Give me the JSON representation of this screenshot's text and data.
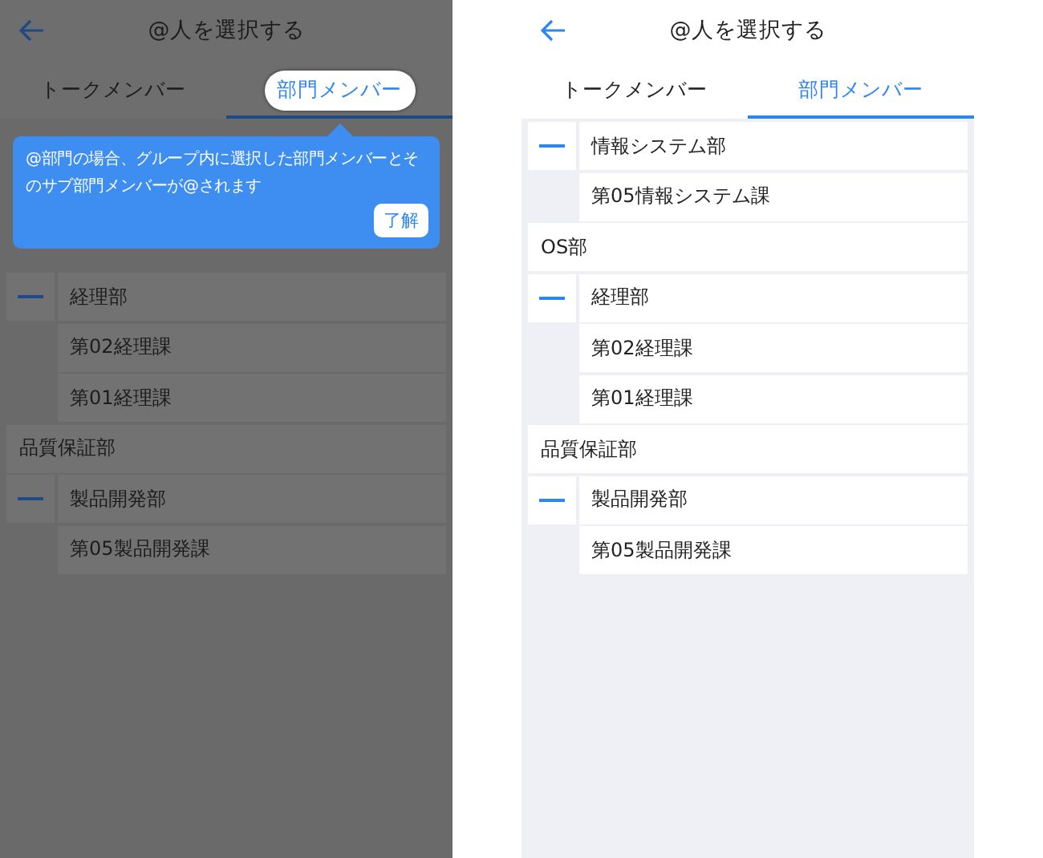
{
  "screens": [
    {
      "dimmed": true,
      "title": "@人を選択する",
      "tabs": [
        {
          "label": "トークメンバー",
          "selected": false,
          "spotlight": false
        },
        {
          "label": "部門メンバー",
          "selected": true,
          "spotlight": true
        }
      ],
      "tooltip": {
        "text": "@部門の場合、グループ内に選択した部門メンバーとそのサブ部門メンバーが@されます",
        "button": "了解"
      },
      "departments": [
        {
          "label": "経理部",
          "expanded": true,
          "children": [
            {
              "label": "第02経理課"
            },
            {
              "label": "第01経理課"
            }
          ]
        },
        {
          "label": "品質保証部"
        },
        {
          "label": "製品開発部",
          "expanded": true,
          "children": [
            {
              "label": "第05製品開発課"
            }
          ]
        }
      ]
    },
    {
      "dimmed": false,
      "title": "@人を選択する",
      "tabs": [
        {
          "label": "トークメンバー",
          "selected": false,
          "spotlight": false
        },
        {
          "label": "部門メンバー",
          "selected": true,
          "spotlight": false
        }
      ],
      "departments": [
        {
          "label": "情報システム部",
          "expanded": true,
          "children": [
            {
              "label": "第05情報システム課"
            }
          ]
        },
        {
          "label": "OS部"
        },
        {
          "label": "経理部",
          "expanded": true,
          "children": [
            {
              "label": "第02経理課"
            },
            {
              "label": "第01経理課"
            }
          ]
        },
        {
          "label": "品質保証部"
        },
        {
          "label": "製品開発部",
          "expanded": true,
          "children": [
            {
              "label": "第05製品開発課"
            }
          ]
        }
      ]
    }
  ]
}
